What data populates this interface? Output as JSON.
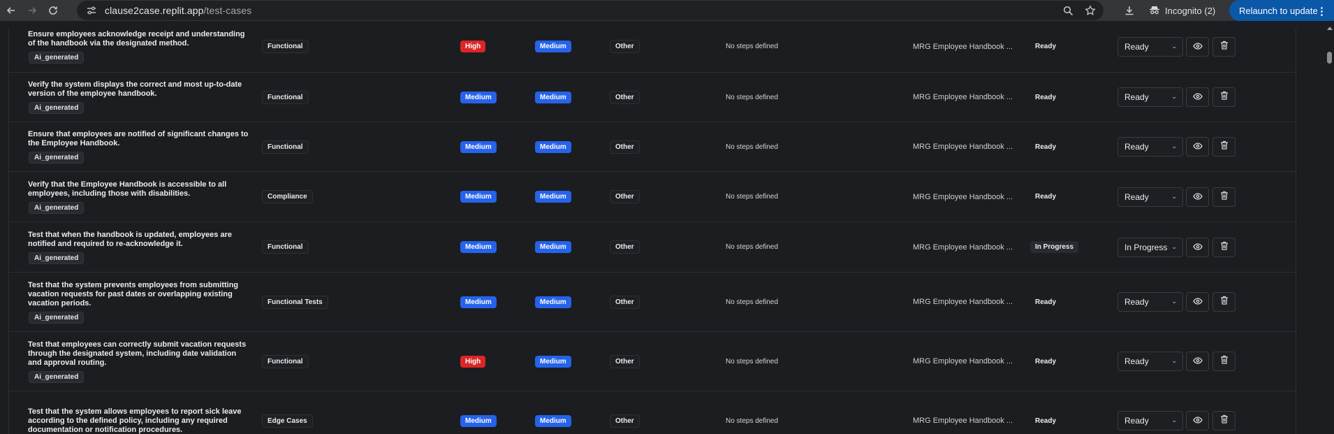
{
  "browser": {
    "url_host": "clause2case.replit.app",
    "url_path": "/test-cases",
    "incognito_label": "Incognito (2)",
    "relaunch_label": "Relaunch to update"
  },
  "rows": [
    {
      "title": "Ensure employees acknowledge receipt and understanding of the handbook via the designated method.",
      "tag": "Ai_generated",
      "type": "Functional",
      "priority": "High",
      "severity": "Medium",
      "category": "Other",
      "steps": "No steps defined",
      "document": "MRG Employee Handbook ...",
      "status": "Ready",
      "status_select": "Ready"
    },
    {
      "title": "Verify the system displays the correct and most up-to-date version of the employee handbook.",
      "tag": "Ai_generated",
      "type": "Functional",
      "priority": "Medium",
      "severity": "Medium",
      "category": "Other",
      "steps": "No steps defined",
      "document": "MRG Employee Handbook ...",
      "status": "Ready",
      "status_select": "Ready"
    },
    {
      "title": "Ensure that employees are notified of significant changes to the Employee Handbook.",
      "tag": "Ai_generated",
      "type": "Functional",
      "priority": "Medium",
      "severity": "Medium",
      "category": "Other",
      "steps": "No steps defined",
      "document": "MRG Employee Handbook ...",
      "status": "Ready",
      "status_select": "Ready"
    },
    {
      "title": "Verify that the Employee Handbook is accessible to all employees, including those with disabilities.",
      "tag": "Ai_generated",
      "type": "Compliance",
      "priority": "Medium",
      "severity": "Medium",
      "category": "Other",
      "steps": "No steps defined",
      "document": "MRG Employee Handbook ...",
      "status": "Ready",
      "status_select": "Ready"
    },
    {
      "title": "Test that when the handbook is updated, employees are notified and required to re-acknowledge it.",
      "tag": "Ai_generated",
      "type": "Functional",
      "priority": "Medium",
      "severity": "Medium",
      "category": "Other",
      "steps": "No steps defined",
      "document": "MRG Employee Handbook ...",
      "status": "In Progress",
      "status_select": "In Progress"
    },
    {
      "title": "Test that the system prevents employees from submitting vacation requests for past dates or overlapping existing vacation periods.",
      "tag": "Ai_generated",
      "type": "Functional Tests",
      "priority": "Medium",
      "severity": "Medium",
      "category": "Other",
      "steps": "No steps defined",
      "document": "MRG Employee Handbook ...",
      "status": "Ready",
      "status_select": "Ready"
    },
    {
      "title": "Test that employees can correctly submit vacation requests through the designated system, including date validation and approval routing.",
      "tag": "Ai_generated",
      "type": "Functional",
      "priority": "High",
      "severity": "Medium",
      "category": "Other",
      "steps": "No steps defined",
      "document": "MRG Employee Handbook ...",
      "status": "Ready",
      "status_select": "Ready"
    },
    {
      "title": "Test that the system allows employees to report sick leave according to the defined policy, including any required documentation or notification procedures.",
      "tag": "",
      "type": "Edge Cases",
      "priority": "Medium",
      "severity": "Medium",
      "category": "Other",
      "steps": "No steps defined",
      "document": "MRG Employee Handbook ...",
      "status": "Ready",
      "status_select": "Ready"
    }
  ]
}
